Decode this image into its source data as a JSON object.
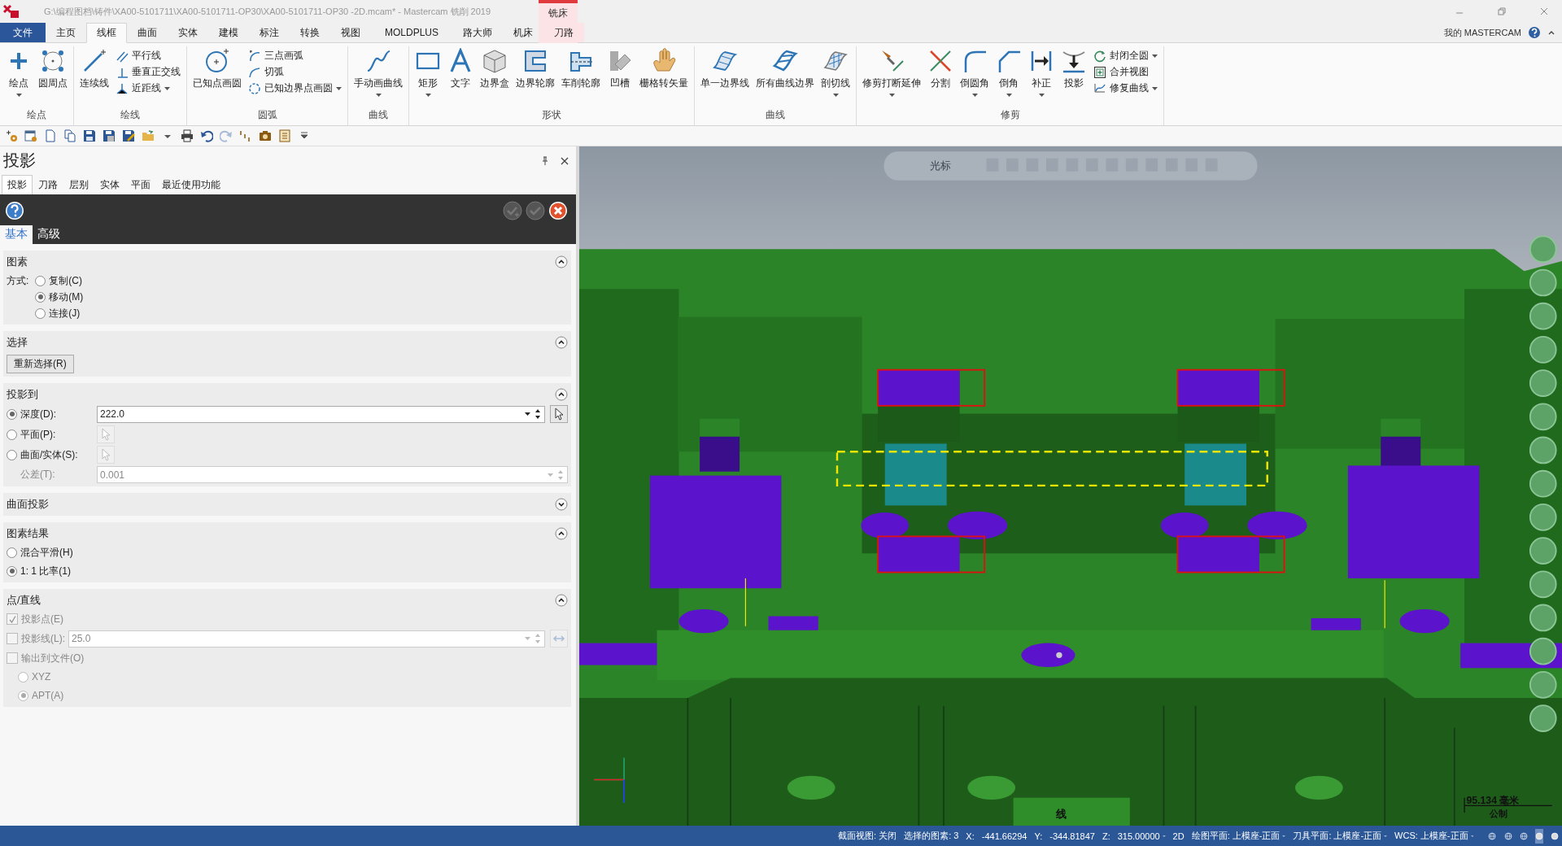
{
  "window": {
    "title": "G:\\编程图档\\铸件\\XA00-5101711\\XA00-5101711-OP30\\XA00-5101711-OP30 -2D.mcam* - Mastercam 铣削 2019",
    "context_caption": "铣床"
  },
  "ribbon_tabs": [
    {
      "label": "文件",
      "kind": "file",
      "selected": false
    },
    {
      "label": "主页",
      "kind": "tab",
      "selected": false
    },
    {
      "label": "线框",
      "kind": "tab",
      "selected": true
    },
    {
      "label": "曲面",
      "kind": "tab",
      "selected": false
    },
    {
      "label": "实体",
      "kind": "tab",
      "selected": false
    },
    {
      "label": "建模",
      "kind": "tab",
      "selected": false
    },
    {
      "label": "标注",
      "kind": "tab",
      "selected": false
    },
    {
      "label": "转换",
      "kind": "tab",
      "selected": false
    },
    {
      "label": "视图",
      "kind": "tab",
      "selected": false
    },
    {
      "label": "MOLDPLUS",
      "kind": "tab",
      "selected": false
    },
    {
      "label": "路大师",
      "kind": "tab",
      "selected": false
    },
    {
      "label": "机床",
      "kind": "tab",
      "selected": false
    },
    {
      "label": "刀路",
      "kind": "context",
      "selected": false
    }
  ],
  "account_link": "我的 MASTERCAM",
  "ribbon": {
    "groups": [
      {
        "label": "绘点",
        "items": [
          {
            "label": "绘点",
            "kind": "large",
            "dropdown": true
          },
          {
            "label": "圆周点",
            "kind": "large",
            "dropdown": false
          }
        ]
      },
      {
        "label": "绘线",
        "items": [
          {
            "label": "连续线",
            "kind": "large",
            "dropdown": false
          },
          {
            "label": "平行线",
            "kind": "small",
            "dropdown": false
          },
          {
            "label": "垂直正交线",
            "kind": "small",
            "dropdown": false
          },
          {
            "label": "近距线",
            "kind": "small",
            "dropdown": true
          }
        ]
      },
      {
        "label": "圆弧",
        "items": [
          {
            "label": "已知点画圆",
            "kind": "large",
            "dropdown": false
          },
          {
            "label": "三点画弧",
            "kind": "small",
            "dropdown": false
          },
          {
            "label": "切弧",
            "kind": "small",
            "dropdown": false
          },
          {
            "label": "已知边界点画圆",
            "kind": "small",
            "dropdown": true
          }
        ]
      },
      {
        "label": "曲线",
        "items": [
          {
            "label": "手动画曲线",
            "kind": "large",
            "dropdown": true
          }
        ]
      },
      {
        "label": "形状",
        "items": [
          {
            "label": "矩形",
            "kind": "large",
            "dropdown": true
          },
          {
            "label": "文字",
            "kind": "large",
            "dropdown": false
          },
          {
            "label": "边界盒",
            "kind": "large",
            "dropdown": false
          },
          {
            "label": "边界轮廓",
            "kind": "large",
            "dropdown": false
          },
          {
            "label": "车削轮廓",
            "kind": "large",
            "dropdown": false
          },
          {
            "label": "凹槽",
            "kind": "large",
            "dropdown": false
          },
          {
            "label": "栅格转矢量",
            "kind": "large",
            "dropdown": false
          }
        ]
      },
      {
        "label": "曲线",
        "items": [
          {
            "label": "单一边界线",
            "kind": "large",
            "dropdown": false
          },
          {
            "label": "所有曲线边界",
            "kind": "large",
            "dropdown": false
          },
          {
            "label": "剖切线",
            "kind": "large",
            "dropdown": true
          }
        ]
      },
      {
        "label": "修剪",
        "items": [
          {
            "label": "修剪打断延伸",
            "kind": "large",
            "dropdown": true
          },
          {
            "label": "分割",
            "kind": "large",
            "dropdown": false
          },
          {
            "label": "倒圆角",
            "kind": "large",
            "dropdown": true
          },
          {
            "label": "倒角",
            "kind": "large",
            "dropdown": true
          },
          {
            "label": "补正",
            "kind": "large",
            "dropdown": true
          },
          {
            "label": "投影",
            "kind": "large",
            "dropdown": false
          },
          {
            "label": "封闭全圆",
            "kind": "small",
            "dropdown": true
          },
          {
            "label": "合并视图",
            "kind": "small",
            "dropdown": false
          },
          {
            "label": "修复曲线",
            "kind": "small",
            "dropdown": true
          }
        ]
      }
    ]
  },
  "panel": {
    "title": "投影",
    "tabs": [
      {
        "label": "投影",
        "selected": true
      },
      {
        "label": "刀路",
        "selected": false
      },
      {
        "label": "层别",
        "selected": false
      },
      {
        "label": "实体",
        "selected": false
      },
      {
        "label": "平面",
        "selected": false
      },
      {
        "label": "最近使用功能",
        "selected": false
      }
    ],
    "subtabs": [
      {
        "label": "基本",
        "selected": true
      },
      {
        "label": "高级",
        "selected": false
      }
    ],
    "sections": [
      {
        "title": "图素",
        "expanded": true,
        "rows": [
          {
            "kind": "radio-set",
            "caption": "方式:",
            "options": [
              {
                "label": "复制(C)",
                "selected": false
              },
              {
                "label": "移动(M)",
                "selected": true
              },
              {
                "label": "连接(J)",
                "selected": false
              }
            ]
          }
        ]
      },
      {
        "title": "选择",
        "expanded": true,
        "rows": [
          {
            "kind": "button",
            "label": "重新选择(R)"
          }
        ]
      },
      {
        "title": "投影到",
        "expanded": true,
        "rows": [
          {
            "kind": "radio",
            "label": "深度(D):",
            "selected": true,
            "disabled": false,
            "field": {
              "value": "222.0",
              "disabled": false
            },
            "action": {
              "kind": "pick",
              "disabled": false
            }
          },
          {
            "kind": "radio",
            "label": "平面(P):",
            "selected": false,
            "disabled": false,
            "action": {
              "kind": "pick",
              "disabled": true
            }
          },
          {
            "kind": "radio",
            "label": "曲面/实体(S):",
            "selected": false,
            "disabled": false,
            "action": {
              "kind": "pick",
              "disabled": true
            }
          },
          {
            "kind": "field",
            "label": "公差(T):",
            "disabled": true,
            "field": {
              "value": "0.001",
              "disabled": true
            }
          }
        ]
      },
      {
        "title": "曲面投影",
        "expanded": false
      },
      {
        "title": "图素结果",
        "expanded": true,
        "rows": [
          {
            "kind": "radio",
            "label": "混合平滑(H)",
            "selected": false,
            "disabled": false
          },
          {
            "kind": "radio",
            "label": "1: 1 比率(1)",
            "selected": true,
            "disabled": false
          }
        ]
      },
      {
        "title": "点/直线",
        "expanded": true,
        "rows": [
          {
            "kind": "check",
            "label": "投影点(E)",
            "checked": true,
            "disabled": true
          },
          {
            "kind": "check",
            "label": "投影线(L):",
            "checked": false,
            "disabled": true,
            "field": {
              "value": "25.0",
              "disabled": true
            },
            "action": {
              "kind": "swap",
              "disabled": true
            }
          },
          {
            "kind": "check",
            "label": "输出到文件(O)",
            "checked": false,
            "disabled": true,
            "children": [
              {
                "label": "XYZ",
                "selected": false,
                "disabled": true
              },
              {
                "label": "APT(A)",
                "selected": true,
                "disabled": true
              }
            ]
          }
        ]
      }
    ]
  },
  "viewport": {
    "toolbar_label": "光标",
    "model_label": "线",
    "scale": "95.134 毫米",
    "units": "公制"
  },
  "status_bar": [
    {
      "text": "截面视图: 关闭",
      "dropdown": false
    },
    {
      "text": "选择的图素: 3",
      "dropdown": false
    },
    {
      "text": "X:",
      "dropdown": false
    },
    {
      "text": "-441.66294",
      "dropdown": false
    },
    {
      "text": "Y:",
      "dropdown": false
    },
    {
      "text": "-344.81847",
      "dropdown": false
    },
    {
      "text": "Z:",
      "dropdown": false
    },
    {
      "text": "315.00000",
      "dropdown": true
    },
    {
      "text": "2D",
      "dropdown": false
    },
    {
      "text": "绘图平面: 上模座-正面",
      "dropdown": true
    },
    {
      "text": "刀具平面: 上模座-正面",
      "dropdown": true
    },
    {
      "text": "WCS: 上模座-正面",
      "dropdown": true
    }
  ]
}
